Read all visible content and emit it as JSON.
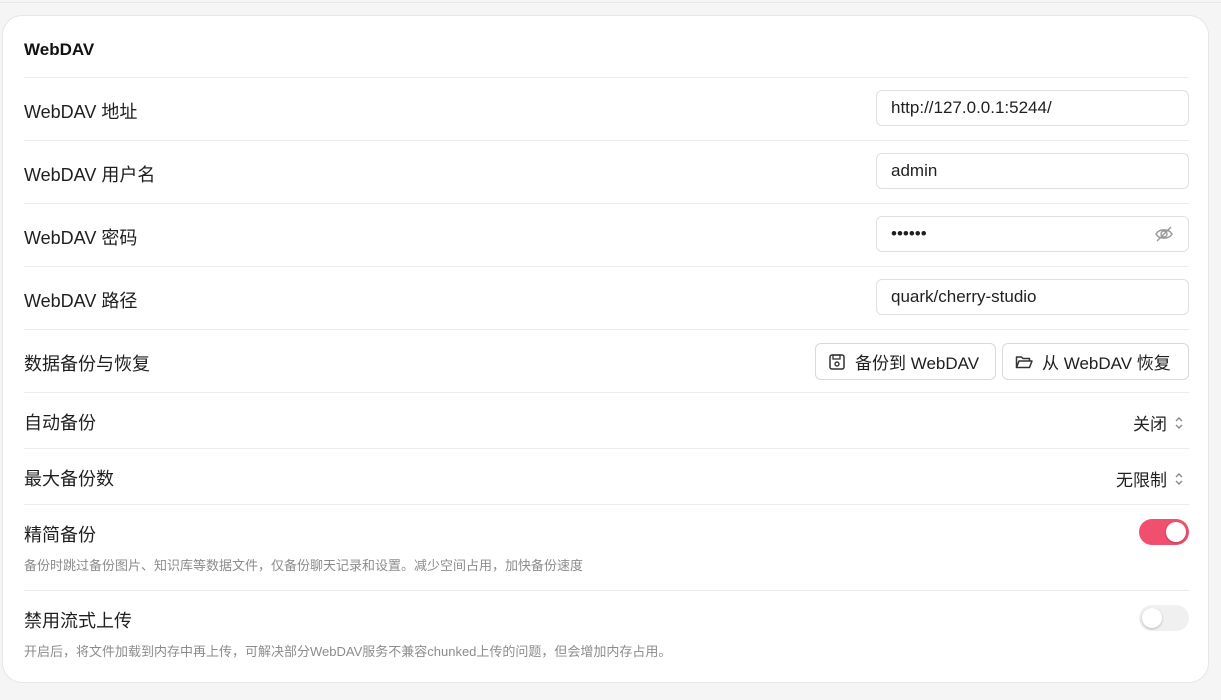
{
  "card": {
    "title": "WebDAV"
  },
  "rows": {
    "address": {
      "label": "WebDAV 地址",
      "value": "http://127.0.0.1:5244/"
    },
    "username": {
      "label": "WebDAV 用户名",
      "value": "admin"
    },
    "password": {
      "label": "WebDAV 密码",
      "value": "••••••"
    },
    "path": {
      "label": "WebDAV 路径",
      "value": "quark/cherry-studio"
    },
    "backup": {
      "label": "数据备份与恢复",
      "backup_button": "备份到 WebDAV",
      "restore_button": "从 WebDAV 恢复"
    },
    "auto_backup": {
      "label": "自动备份",
      "value": "关闭"
    },
    "max_backups": {
      "label": "最大备份数",
      "value": "无限制"
    },
    "lite_backup": {
      "label": "精简备份",
      "description": "备份时跳过备份图片、知识库等数据文件，仅备份聊天记录和设置。减少空间占用，加快备份速度",
      "enabled": true
    },
    "disable_stream": {
      "label": "禁用流式上传",
      "description": "开启后，将文件加载到内存中再上传，可解决部分WebDAV服务不兼容chunked上传的问题，但会增加内存占用。",
      "enabled": false
    }
  },
  "colors": {
    "accent": "#f0506e",
    "toggle_off": "#f0f0f0"
  }
}
